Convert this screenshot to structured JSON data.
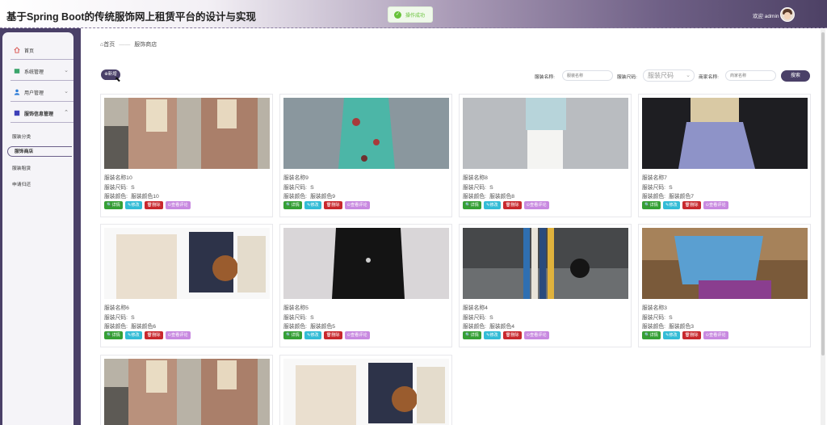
{
  "header": {
    "title": "基于Spring Boot的传统服饰网上租赁平台的设计与实现",
    "welcome": "欢迎 admin"
  },
  "toast": {
    "text": "操作成功"
  },
  "sidebar": {
    "items": [
      {
        "label": "首页",
        "icon": "home-icon",
        "color": "#d9534f"
      },
      {
        "label": "系统管理",
        "icon": "system-icon",
        "color": "#3aa56b"
      },
      {
        "label": "用户管理",
        "icon": "user-icon",
        "color": "#2f7ed8"
      },
      {
        "label": "服饰信息管理",
        "icon": "clothing-icon",
        "color": "#3d3fb8"
      }
    ],
    "subitems": [
      {
        "label": "服装分类"
      },
      {
        "label": "服饰商店"
      },
      {
        "label": "服装租赁"
      },
      {
        "label": "申请归还"
      }
    ]
  },
  "breadcrumb": {
    "home": "首页",
    "current": "服饰商店"
  },
  "toolbar": {
    "add_label": "新增",
    "name_label": "服装名称:",
    "name_placeholder": "服装名称",
    "size_label": "服装尺码:",
    "size_placeholder": "服装尺码",
    "shop_label": "商家名称:",
    "shop_placeholder": "商家名称",
    "search_label": "搜索"
  },
  "buttons": {
    "detail": "详情",
    "edit": "修改",
    "delete": "删除",
    "comments": "查看评论"
  },
  "field_labels": {
    "name": "服装名称",
    "size": "服装尺码:",
    "color": "服装颜色:"
  },
  "products": [
    {
      "name": "服装名称10",
      "size": "S",
      "color": "服装颜色10"
    },
    {
      "name": "服装名称9",
      "size": "S",
      "color": "服装颜色9"
    },
    {
      "name": "服装名称8",
      "size": "S",
      "color": "服装颜色8"
    },
    {
      "name": "服装名称7",
      "size": "S",
      "color": "服装颜色7"
    },
    {
      "name": "服装名称6",
      "size": "S",
      "color": "服装颜色6"
    },
    {
      "name": "服装名称5",
      "size": "S",
      "color": "服装颜色5"
    },
    {
      "name": "服装名称4",
      "size": "S",
      "color": "服装颜色4"
    },
    {
      "name": "服装名称3",
      "size": "S",
      "color": "服装颜色3"
    }
  ]
}
